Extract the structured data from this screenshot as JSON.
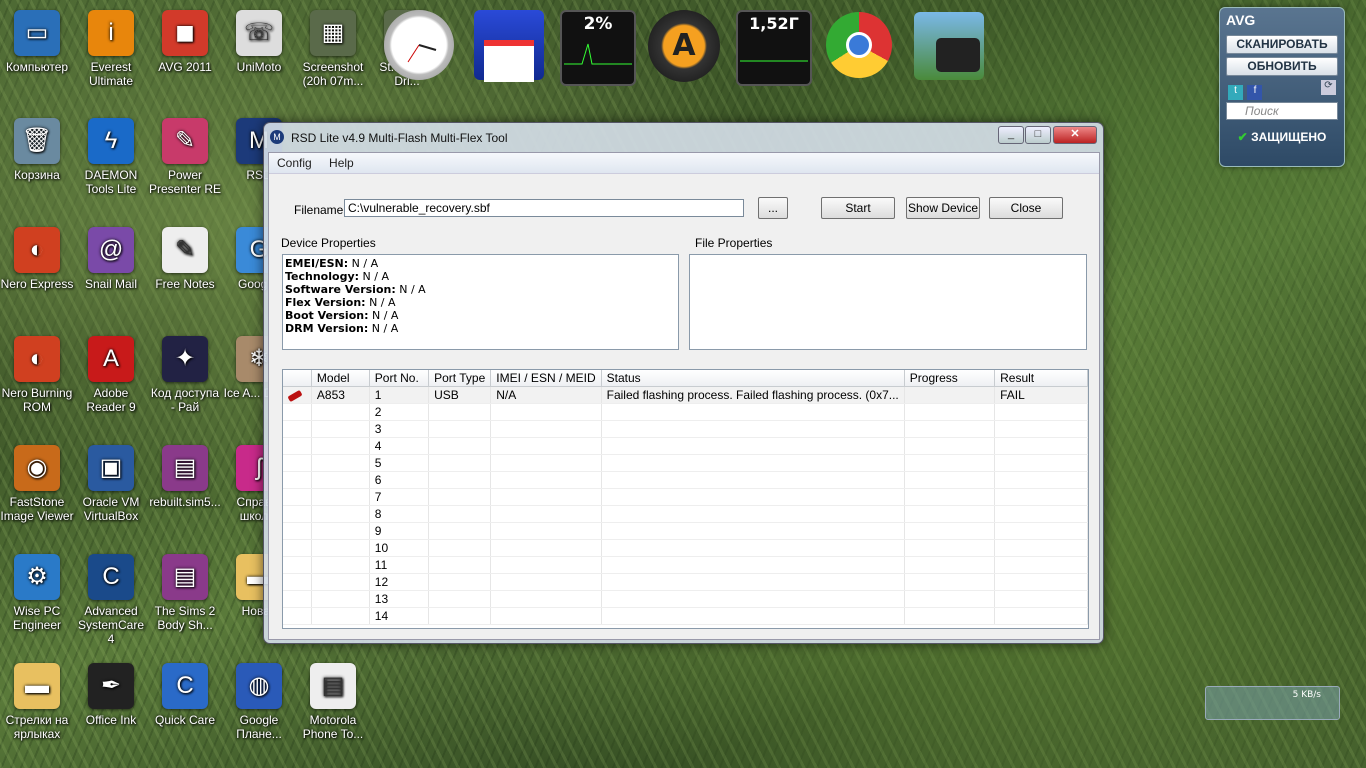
{
  "desktop": {
    "icons": [
      {
        "label": "Компьютер",
        "color": "#2a6fb8",
        "glyph": "▭",
        "name": "computer-icon"
      },
      {
        "label": "Everest Ultimate",
        "color": "#e8860c",
        "glyph": "i",
        "name": "everest-icon"
      },
      {
        "label": "AVG 2011",
        "color": "#d23a2a",
        "glyph": "◼",
        "name": "avg-icon"
      },
      {
        "label": "UniMoto",
        "color": "#dddddd",
        "glyph": "☏",
        "name": "phone-icon"
      },
      {
        "label": "Screenshot (20h 07m...",
        "color": "#5a6a4a",
        "glyph": "▦",
        "name": "screenshot-icon"
      },
      {
        "label": "St... Busta Dri...",
        "color": "#5a6a4a",
        "glyph": "▦",
        "name": "file-icon"
      },
      {
        "label": "Корзина",
        "color": "#6a8aa0",
        "glyph": "🗑",
        "name": "recycle-bin-icon"
      },
      {
        "label": "DAEMON Tools Lite",
        "color": "#1a6ac8",
        "glyph": "ϟ",
        "name": "daemon-tools-icon"
      },
      {
        "label": "Power Presenter RE",
        "color": "#c83a6a",
        "glyph": "✎",
        "name": "presenter-icon"
      },
      {
        "label": "RSD",
        "color": "#1c3a7a",
        "glyph": "M",
        "name": "motorola-icon"
      },
      {
        "label": "Nero Express",
        "color": "#d04020",
        "glyph": "◐",
        "name": "nero-icon"
      },
      {
        "label": "Snail Mail",
        "color": "#7a4aa8",
        "glyph": "@",
        "name": "snail-mail-icon"
      },
      {
        "label": "Free Notes",
        "color": "#eeeeee",
        "glyph": "✎",
        "name": "notes-icon"
      },
      {
        "label": "Googl...",
        "color": "#3a8ad8",
        "glyph": "G",
        "name": "google-icon"
      },
      {
        "label": "Nero Burning ROM",
        "color": "#d04020",
        "glyph": "◐",
        "name": "nero-burning-icon"
      },
      {
        "label": "Adobe Reader 9",
        "color": "#c81a1a",
        "glyph": "A",
        "name": "adobe-reader-icon"
      },
      {
        "label": "Код доступа - Рай",
        "color": "#222244",
        "glyph": "✦",
        "name": "game-icon"
      },
      {
        "label": "Ice A... Dawn",
        "color": "#a88a6a",
        "glyph": "❄",
        "name": "ice-age-icon"
      },
      {
        "label": "FastStone Image Viewer",
        "color": "#c86a1a",
        "glyph": "◉",
        "name": "faststone-icon"
      },
      {
        "label": "Oracle VM VirtualBox",
        "color": "#2a5aa0",
        "glyph": "▣",
        "name": "virtualbox-icon"
      },
      {
        "label": "rebuilt.sim5...",
        "color": "#8a3a8a",
        "glyph": "▤",
        "name": "archive-icon"
      },
      {
        "label": "Справ... школ...",
        "color": "#c82a8a",
        "glyph": "ʃ",
        "name": "reference-icon"
      },
      {
        "label": "Wise PC Engineer",
        "color": "#2a7ac8",
        "glyph": "⚙",
        "name": "wise-pc-icon"
      },
      {
        "label": "Advanced SystemCare 4",
        "color": "#1a4a8a",
        "glyph": "C",
        "name": "systemcare-icon"
      },
      {
        "label": "The Sims 2 Body Sh...",
        "color": "#8a3a8a",
        "glyph": "▤",
        "name": "archive-icon-2"
      },
      {
        "label": "Новая",
        "color": "#e8c060",
        "glyph": "▬",
        "name": "folder-icon"
      },
      {
        "label": "Стрелки на ярлыках",
        "color": "#e8c060",
        "glyph": "▬",
        "name": "folder-icon-2"
      },
      {
        "label": "Office Ink",
        "color": "#222222",
        "glyph": "✒",
        "name": "office-ink-icon"
      },
      {
        "label": "Quick Care",
        "color": "#2a6ac8",
        "glyph": "C",
        "name": "quick-care-icon"
      },
      {
        "label": "Google Плане...",
        "color": "#2a5ab8",
        "glyph": "◍",
        "name": "google-earth-icon"
      },
      {
        "label": "Motorola Phone To...",
        "color": "#eeeeee",
        "glyph": "▤",
        "name": "document-icon"
      }
    ],
    "gadgets": {
      "cpu": "2%",
      "ram": "1,52Г",
      "net": "5 KB/s"
    },
    "avg": {
      "title": "AVG",
      "scan": "СКАНИРОВАТЬ",
      "update": "ОБНОВИТЬ",
      "search_placeholder": "Поиск",
      "status": "ЗАЩИЩЕНО"
    }
  },
  "window": {
    "title": "RSD Lite v4.9 Multi-Flash   Multi-Flex Tool",
    "menu": [
      "Config",
      "Help"
    ],
    "filename_label": "Filename:",
    "filename_value": "C:\\vulnerable_recovery.sbf",
    "browse": "...",
    "start": "Start",
    "show_device": "Show Device",
    "close": "Close",
    "device_props_label": "Device Properties",
    "file_props_label": "File Properties",
    "device_props": [
      {
        "k": "EMEI/ESN:",
        "v": " N / A"
      },
      {
        "k": "Technology:",
        "v": " N / A"
      },
      {
        "k": "Software Version:",
        "v": " N / A"
      },
      {
        "k": "Flex Version:",
        "v": " N / A"
      },
      {
        "k": "Boot Version:",
        "v": " N / A"
      },
      {
        "k": "DRM Version:",
        "v": " N / A"
      }
    ],
    "columns": [
      "",
      "Model",
      "Port No.",
      "Port Type",
      "IMEI / ESN / MEID",
      "Status",
      "Progress",
      "Result"
    ],
    "rows": [
      {
        "model": "A853",
        "port": "1",
        "type": "USB",
        "imei": "N/A",
        "status": "Failed flashing process. Failed flashing process.  (0x7...",
        "progress": "",
        "result": "FAIL"
      },
      {
        "model": "",
        "port": "2",
        "type": "",
        "imei": "",
        "status": "",
        "progress": "",
        "result": ""
      },
      {
        "model": "",
        "port": "3",
        "type": "",
        "imei": "",
        "status": "",
        "progress": "",
        "result": ""
      },
      {
        "model": "",
        "port": "4",
        "type": "",
        "imei": "",
        "status": "",
        "progress": "",
        "result": ""
      },
      {
        "model": "",
        "port": "5",
        "type": "",
        "imei": "",
        "status": "",
        "progress": "",
        "result": ""
      },
      {
        "model": "",
        "port": "6",
        "type": "",
        "imei": "",
        "status": "",
        "progress": "",
        "result": ""
      },
      {
        "model": "",
        "port": "7",
        "type": "",
        "imei": "",
        "status": "",
        "progress": "",
        "result": ""
      },
      {
        "model": "",
        "port": "8",
        "type": "",
        "imei": "",
        "status": "",
        "progress": "",
        "result": ""
      },
      {
        "model": "",
        "port": "9",
        "type": "",
        "imei": "",
        "status": "",
        "progress": "",
        "result": ""
      },
      {
        "model": "",
        "port": "10",
        "type": "",
        "imei": "",
        "status": "",
        "progress": "",
        "result": ""
      },
      {
        "model": "",
        "port": "11",
        "type": "",
        "imei": "",
        "status": "",
        "progress": "",
        "result": ""
      },
      {
        "model": "",
        "port": "12",
        "type": "",
        "imei": "",
        "status": "",
        "progress": "",
        "result": ""
      },
      {
        "model": "",
        "port": "13",
        "type": "",
        "imei": "",
        "status": "",
        "progress": "",
        "result": ""
      },
      {
        "model": "",
        "port": "14",
        "type": "",
        "imei": "",
        "status": "",
        "progress": "",
        "result": ""
      }
    ]
  }
}
